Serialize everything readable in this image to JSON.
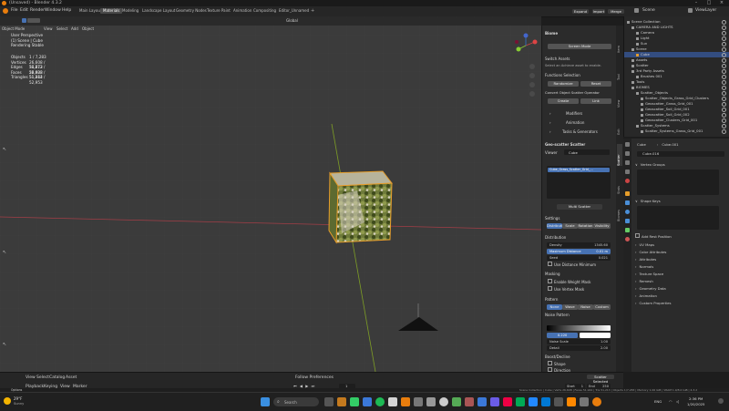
{
  "window": {
    "title": "(Unsaved) - Blender 4.3.2"
  },
  "menu": {
    "items": [
      "File",
      "Edit",
      "Render",
      "Window",
      "Help"
    ],
    "workspaces": [
      "Main Layout",
      "Materials",
      "Modeling",
      "Landscape Layout",
      "Geometry Nodes",
      "Texture Paint",
      "Animation",
      "Compositing",
      "Editor_Unnamed"
    ],
    "active_workspace": "Materials",
    "right": {
      "scene_label": "Scene",
      "view_layer_label": "ViewLayer"
    }
  },
  "viewport": {
    "header": {
      "mode": "Object Mode",
      "items": [
        "View",
        "Select",
        "Add",
        "Object"
      ],
      "transform": "Global",
      "options_label": "Options"
    },
    "overlay": {
      "line1": "User Perspective",
      "line2": "(1) Scene | Cube",
      "line3": "Rendering Stable",
      "stats": [
        {
          "label": "Objects",
          "value": "1 / 7,283"
        },
        {
          "label": "Vertices",
          "value": "26,608 / 34,672"
        },
        {
          "label": "Edges",
          "value": "51,213 / 52,923"
        },
        {
          "label": "Faces",
          "value": "26,608 / 51,944"
        },
        {
          "label": "Triangles",
          "value": "51,213 / 52,953"
        }
      ]
    }
  },
  "npanel": {
    "header": "Scatter",
    "section1_title": "Biome",
    "screen_mode_btn": "Screen Mode",
    "switch_assets_label": "Switch Assets",
    "switch_assets_text": "Select an Achieve asset to enable.",
    "functions_label": "Functions Selection",
    "btn_randomize": "Randomize",
    "btn_reset": "Reset",
    "scatter_obj_label": "Convert Object Scatter Operator",
    "btn_create": "Create",
    "btn_link": "Link",
    "rows": [
      "Modifiers",
      "Animation",
      "Tasks & Generators"
    ],
    "scatter_layers_title": "Geo-scatter Scatter",
    "viewer_label": "Viewer",
    "viewer_value": "Cube",
    "list_item": "Cube_Grass_Scatter_Grid_...",
    "multi_scatter_btn": "Multi Scatter",
    "settings_label": "Settings",
    "settings_tabs": [
      "Distribution",
      "Scale",
      "Rotation",
      "Visibility"
    ],
    "distribution_label": "Distribution",
    "dist_rows": [
      {
        "label": "Density",
        "value": "1345.60"
      },
      {
        "label": "Maximum Distance",
        "value": "0.01 m"
      },
      {
        "label": "Seed",
        "value": "0.021"
      }
    ],
    "use_distance_label": "Use Distance Minimum",
    "masking_label": "Masking",
    "mask_rows": [
      "Enable Weight Mask",
      "Use Vertex Mask"
    ],
    "pattern_label": "Pattern",
    "pattern_tabs": [
      "None",
      "Wave",
      "Noise",
      "Custom"
    ],
    "noise_label": "Noise Pattern",
    "noise_value1": "0.00",
    "noise_value2": "0.220",
    "noise_scale_label": "Noise Scale",
    "noise_scale_value": "1.00",
    "detail_label": "Detail",
    "detail_value": "2.00",
    "boost_label": "Boost/Decline",
    "boost_rows": [
      "Shape",
      "Direction"
    ]
  },
  "npanel_tabs": [
    "Item",
    "Tool",
    "View",
    "Edit",
    "Scatter",
    "Stats",
    "Biomes"
  ],
  "outliner": {
    "rows": [
      {
        "label": "Scene Collection",
        "indent": 0,
        "selected": false
      },
      {
        "label": "CAMERA AND LIGHTS",
        "indent": 1,
        "selected": false
      },
      {
        "label": "Camera",
        "indent": 2,
        "selected": false
      },
      {
        "label": "Light",
        "indent": 2,
        "selected": false
      },
      {
        "label": "Sun",
        "indent": 2,
        "selected": false
      },
      {
        "label": "Scene",
        "indent": 1,
        "selected": false
      },
      {
        "label": "Cube",
        "indent": 2,
        "selected": true
      },
      {
        "label": "Assets",
        "indent": 1,
        "selected": false
      },
      {
        "label": "Scatter",
        "indent": 1,
        "selected": false
      },
      {
        "label": "3rd Party Assets",
        "indent": 1,
        "selected": false
      },
      {
        "label": "Brushes 001",
        "indent": 2,
        "selected": false
      },
      {
        "label": "Tools",
        "indent": 1,
        "selected": false
      },
      {
        "label": "BIOMES",
        "indent": 1,
        "selected": false
      },
      {
        "label": "Scatter_Objects",
        "indent": 2,
        "selected": false
      },
      {
        "label": "Scatter_Objects_Grass_Grid_Clusters",
        "indent": 3,
        "selected": false
      },
      {
        "label": "Geoscatter_Grass_Grid_001",
        "indent": 3,
        "selected": false
      },
      {
        "label": "Geoscatter_Soil_Grid_001",
        "indent": 3,
        "selected": false
      },
      {
        "label": "Geoscatter_Soil_Grid_002",
        "indent": 3,
        "selected": false
      },
      {
        "label": "Geoscatter_Clusters_Grid_001",
        "indent": 3,
        "selected": false
      },
      {
        "label": "Scatter_Systems",
        "indent": 2,
        "selected": false
      },
      {
        "label": "Scatter_Systems_Grass_Grid_001",
        "indent": 3,
        "selected": false
      }
    ]
  },
  "properties": {
    "obj_name": "Cube",
    "mesh_name": "Cube.001",
    "data_name": "Cube.016",
    "sections": [
      "Vertex Groups",
      "Shape Keys",
      "UV Maps",
      "Color Attributes",
      "Attributes",
      "Normals",
      "Texture Space",
      "Remesh",
      "Geometry Data",
      "Animation",
      "Custom Properties"
    ],
    "add_rest": "Add Rest Position"
  },
  "timeline": {
    "items": [
      "View",
      "Select",
      "Catalog",
      "Asset"
    ],
    "playback": "Playback",
    "keying": "Keying",
    "view": "View",
    "marker": "Marker",
    "frame": "1",
    "start_label": "Start",
    "start": "1",
    "end_label": "End",
    "end": "250",
    "center_label": "Follow Preferences",
    "scatter_label": "Scatter Selected",
    "options_label": "Options"
  },
  "statusbar": {
    "text": "Scene Collection | Cube | Verts 26,608 | Faces 51,944 | Tris 51,213 | Objects 1/7,283 | Memory 1.06 GiB | VRAM 1.9/8.0 GiB | 4.3.2"
  },
  "taskbar": {
    "weather_temp": "29°F",
    "weather_desc": "Sunny",
    "search_placeholder": "Search",
    "lang": "ENG",
    "time": "2:36 PM",
    "date": "1/20/2025"
  },
  "colors": {
    "accent": "#4772b3",
    "selected_outline": "#e69d2a",
    "x_axis": "#a33e47",
    "y_axis": "#7e9e26"
  }
}
